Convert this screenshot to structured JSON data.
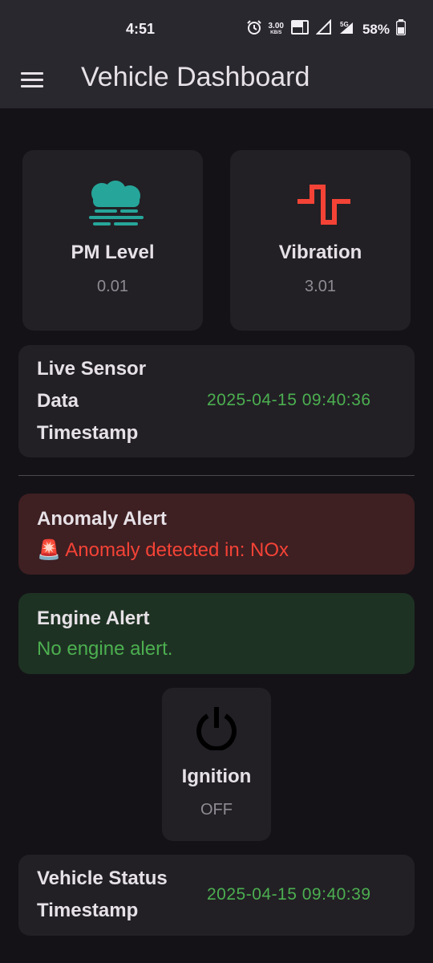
{
  "status_bar": {
    "time": "4:51",
    "speed_value": "3.00",
    "speed_unit": "KB/S",
    "network": "5G",
    "battery_pct": "58%",
    "icons": [
      "alarm-icon",
      "data-speed-icon",
      "volte-icon",
      "signal-icon",
      "5g-signal-icon",
      "battery-icon"
    ]
  },
  "app_bar": {
    "title": "Vehicle Dashboard",
    "menu_icon": "hamburger-menu-icon"
  },
  "tiles": [
    {
      "icon": "fog-cloud-icon",
      "title": "PM Level",
      "value": "0.01",
      "color": "#26a69a"
    },
    {
      "icon": "vibration-wave-icon",
      "title": "Vibration",
      "value": "3.01",
      "color": "#f44336"
    }
  ],
  "live_sensor": {
    "label_lines": [
      "Live Sensor",
      "Data",
      "Timestamp"
    ],
    "timestamp": "2025-04-15 09:40:36"
  },
  "anomaly_alert": {
    "title": "Anomaly Alert",
    "emoji": "🚨",
    "message": "Anomaly detected in: NOx",
    "bg": "#3e1f22",
    "color": "#f44336"
  },
  "engine_alert": {
    "title": "Engine Alert",
    "message": "No engine alert.",
    "bg": "#1e3223",
    "color": "#4caf50"
  },
  "ignition": {
    "icon": "power-icon",
    "title": "Ignition",
    "value": "OFF"
  },
  "vehicle_status": {
    "label_lines": [
      "Vehicle Status",
      "Timestamp"
    ],
    "timestamp": "2025-04-15 09:40:39"
  },
  "colors": {
    "background": "#141217",
    "surface": "#222025",
    "appbar": "#2a282f",
    "timestamp_green": "#4caf50"
  }
}
